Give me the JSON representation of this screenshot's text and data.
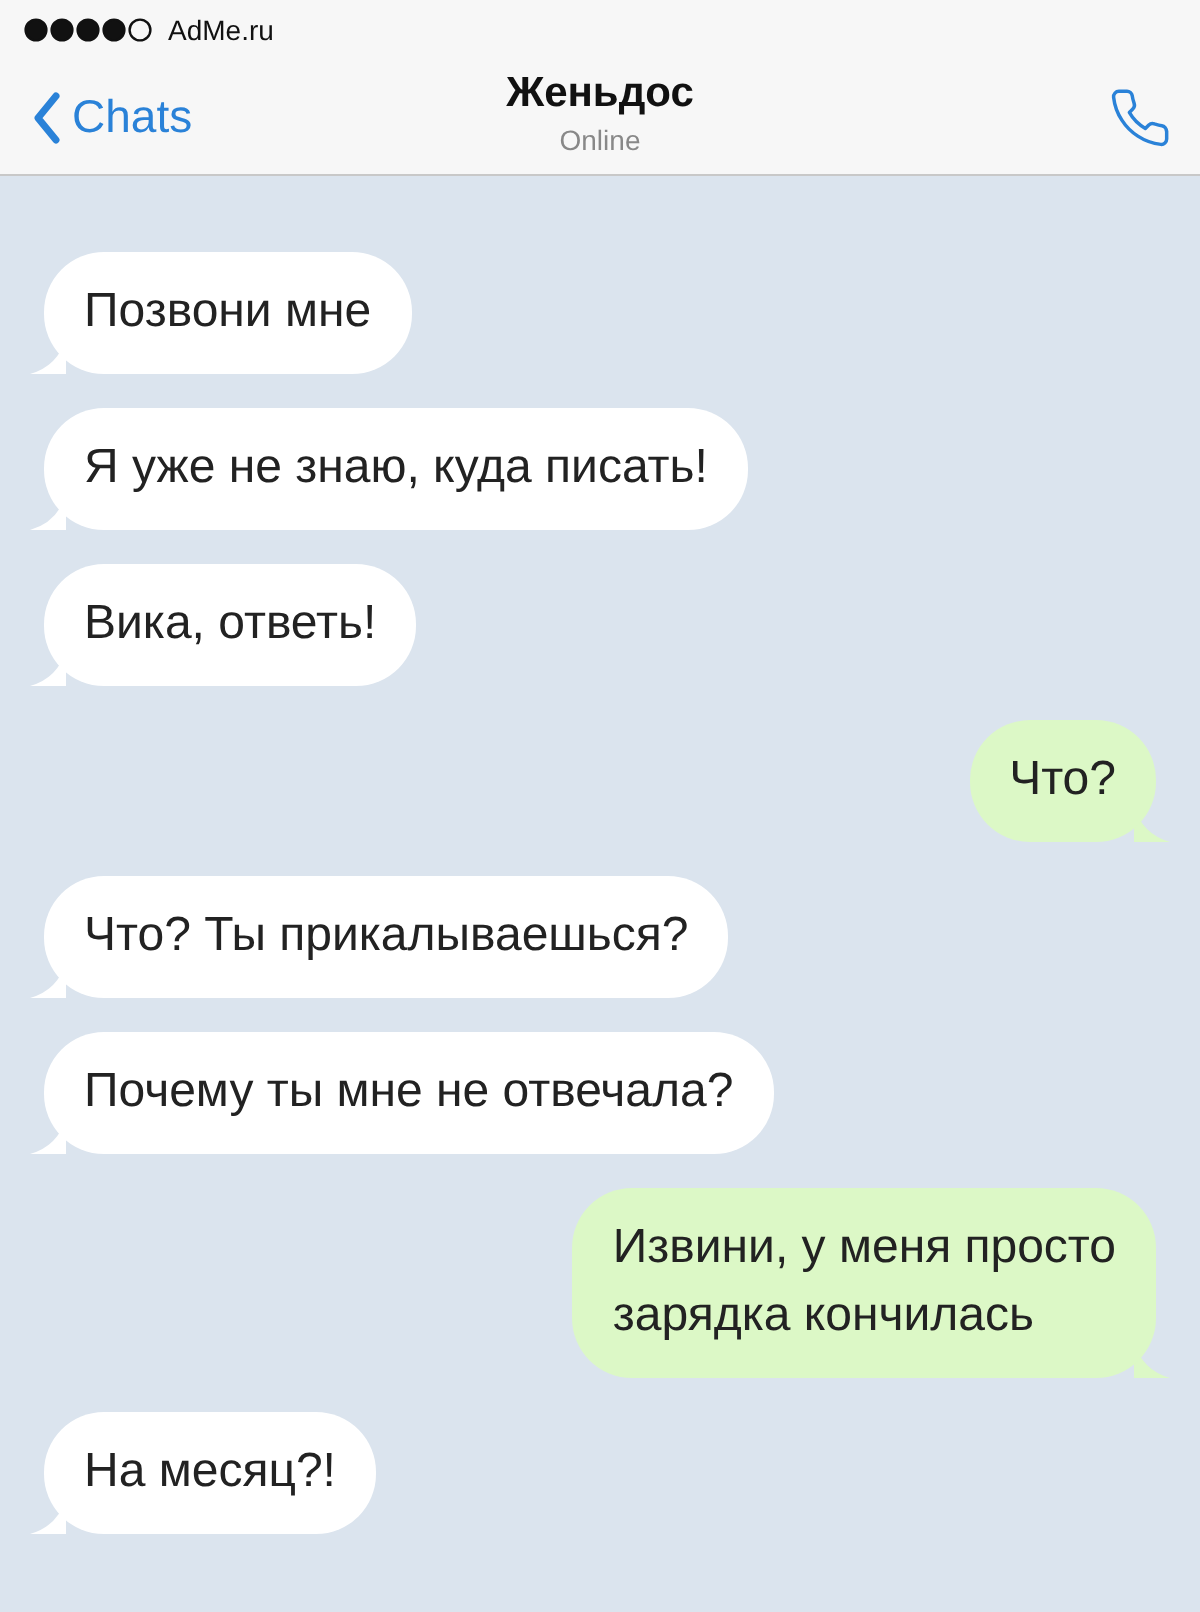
{
  "status_bar": {
    "carrier": "AdMe.ru"
  },
  "header": {
    "back_label": "Chats",
    "title": "Женьдос",
    "subtitle": "Online"
  },
  "messages": [
    {
      "text": "Позвони мне",
      "kind": "incoming"
    },
    {
      "text": "Я уже не знаю, куда писать!",
      "kind": "incoming"
    },
    {
      "text": "Вика, ответь!",
      "kind": "incoming"
    },
    {
      "text": "Что?",
      "kind": "outgoing"
    },
    {
      "text": "Что? Ты прикалываешься?",
      "kind": "incoming"
    },
    {
      "text": "Почему ты мне не отвечала?",
      "kind": "incoming"
    },
    {
      "text": "Извини, у меня просто\nзарядка кончилась",
      "kind": "outgoing"
    },
    {
      "text": "На месяц?!",
      "kind": "incoming"
    }
  ]
}
